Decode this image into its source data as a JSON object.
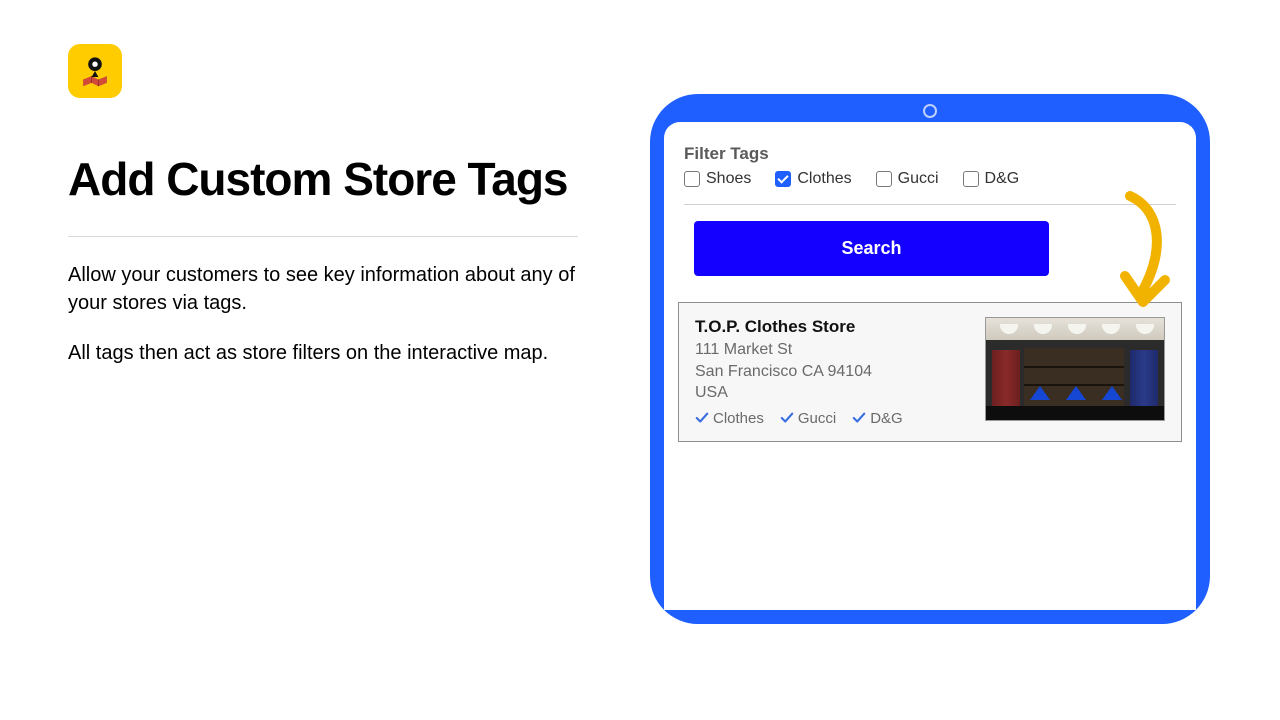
{
  "left": {
    "heading": "Add Custom Store Tags",
    "para1": "Allow your customers to see key information about any of your stores via tags.",
    "para2": "All tags then act as store filters on the interactive map."
  },
  "filter": {
    "title": "Filter Tags",
    "items": [
      {
        "label": "Shoes",
        "checked": false
      },
      {
        "label": "Clothes",
        "checked": true
      },
      {
        "label": "Gucci",
        "checked": false
      },
      {
        "label": "D&G",
        "checked": false
      }
    ],
    "search_label": "Search"
  },
  "store": {
    "name": "T.O.P. Clothes Store",
    "addr1": "111 Market St",
    "addr2": "San Francisco CA 94104",
    "addr3": "USA",
    "tags": [
      "Clothes",
      "Gucci",
      "D&G"
    ]
  },
  "colors": {
    "accent": "#1f5fff",
    "button": "#1400ff",
    "icon_bg": "#ffcc00",
    "check": "#1f5fff"
  }
}
